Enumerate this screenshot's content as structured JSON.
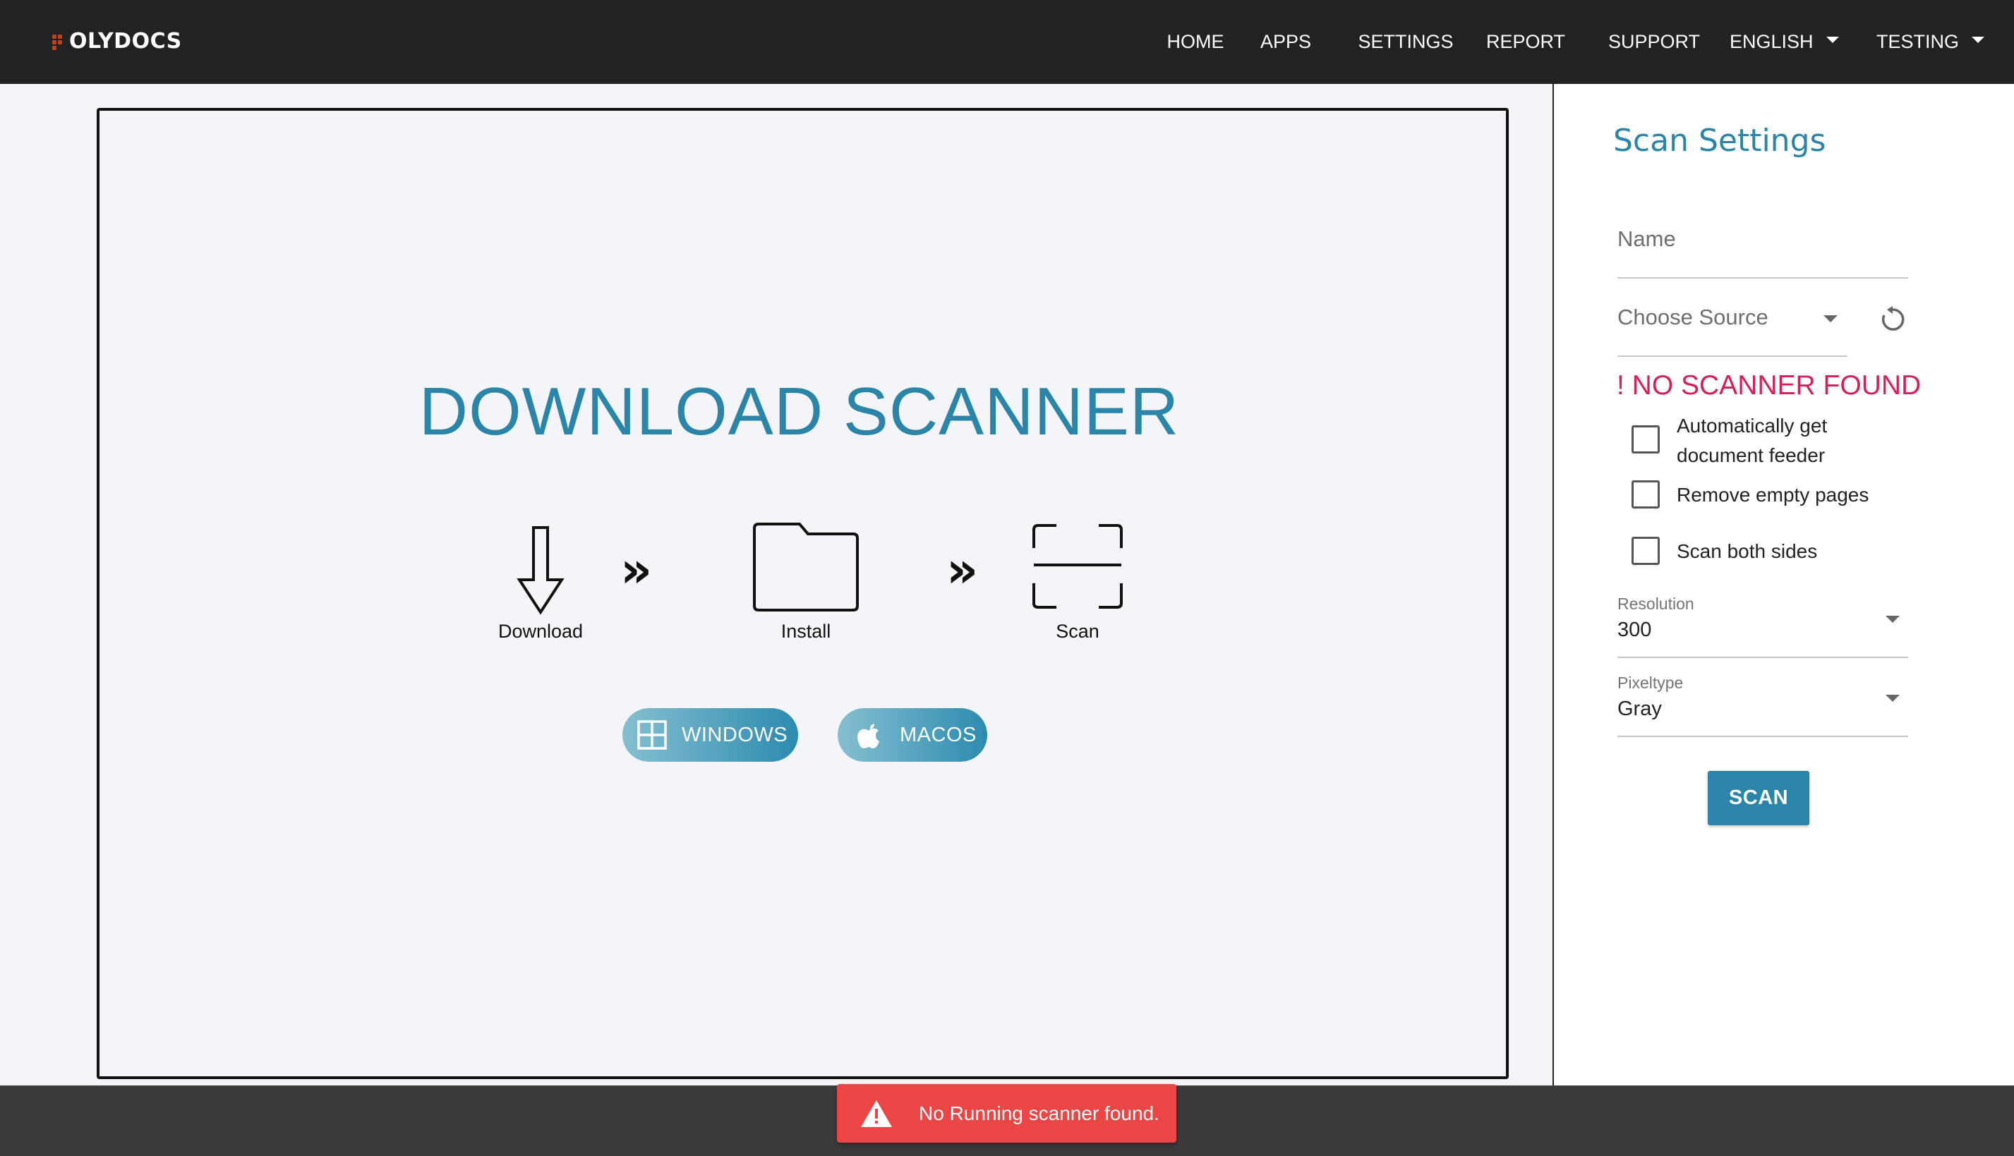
{
  "navbar": {
    "logo_text": "OLYDOCS",
    "items": [
      "HOME",
      "APPS",
      "SETTINGS",
      "REPORT",
      "SUPPORT"
    ],
    "language": "ENGLISH",
    "user": "TESTING"
  },
  "viewer": {
    "title": "DOWNLOAD SCANNER",
    "steps": [
      "Download",
      "Install",
      "Scan"
    ],
    "os_buttons": {
      "windows": "WINDOWS",
      "macos": "MACOS"
    }
  },
  "settings": {
    "title": "Scan Settings",
    "name_placeholder": "Name",
    "source_placeholder": "Choose Source",
    "error": "! NO SCANNER FOUND",
    "checkboxes": [
      {
        "label": "Automatically get document feeder",
        "checked": false
      },
      {
        "label": "Remove empty pages",
        "checked": false
      },
      {
        "label": "Scan both sides",
        "checked": false
      }
    ],
    "resolution_label": "Resolution",
    "resolution_value": "300",
    "pixeltype_label": "Pixeltype",
    "pixeltype_value": "Gray",
    "scan_button": "SCAN"
  },
  "toast": {
    "message": "No Running scanner found."
  },
  "colors": {
    "accent": "#2a85a8",
    "error": "#d62058",
    "toast": "#ec4545",
    "navbar": "#222222"
  }
}
